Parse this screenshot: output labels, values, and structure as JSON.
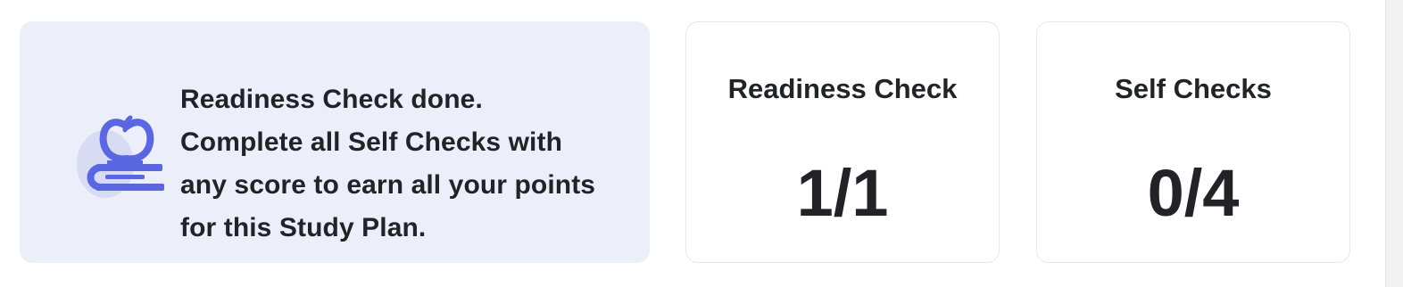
{
  "banner": {
    "icon": "apple-on-book-icon",
    "lines": [
      "Readiness Check done.",
      "Complete all Self Checks with",
      "any score to earn all your points",
      "for this Study Plan."
    ],
    "background": "#eceff9",
    "icon_color": "#5a67e0"
  },
  "stats": [
    {
      "title": "Readiness Check",
      "value": "1/1"
    },
    {
      "title": "Self Checks",
      "value": "0/4"
    }
  ]
}
